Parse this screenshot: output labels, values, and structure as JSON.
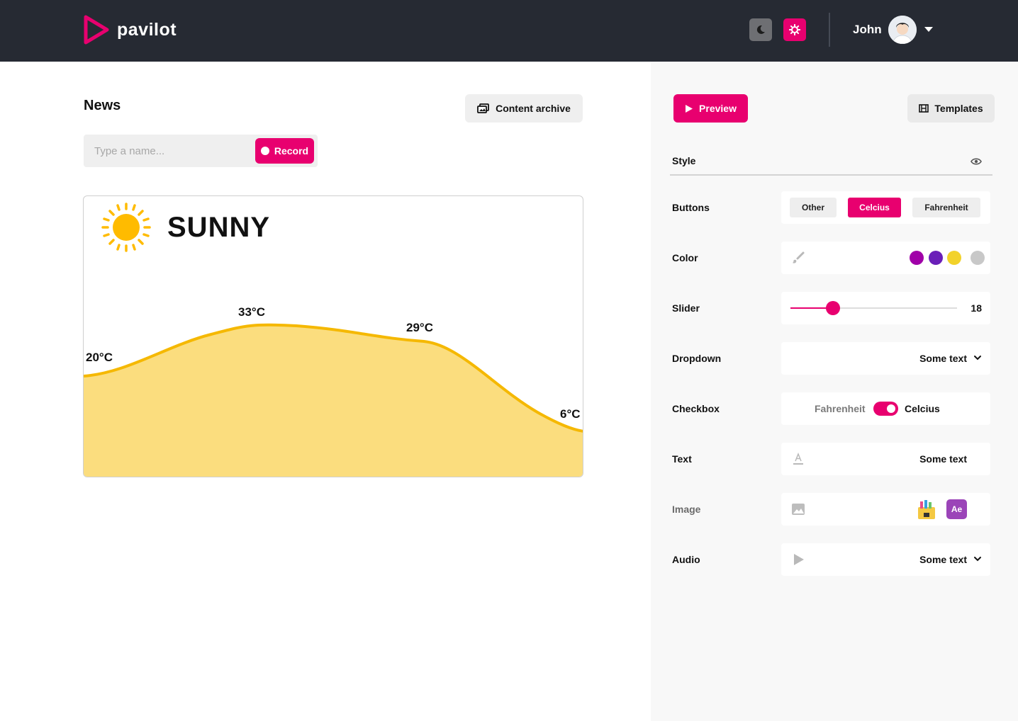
{
  "header": {
    "brand": "pavilot",
    "user_name": "John",
    "icons": {
      "theme_dark": "moon-icon",
      "theme_light": "sun-gear-icon",
      "user_menu": "caret-down-icon"
    },
    "colors": {
      "background": "#262a33",
      "accent": "#e8006f"
    }
  },
  "main": {
    "title": "News",
    "content_archive_label": "Content archive",
    "name_placeholder": "Type a name...",
    "record_label": "Record",
    "weather": {
      "condition": "SUNNY",
      "temps": [
        "20°C",
        "33°C",
        "29°C",
        "6°C"
      ]
    }
  },
  "panel": {
    "preview_label": "Preview",
    "templates_label": "Templates",
    "style_label": "Style",
    "rows": {
      "buttons": {
        "label": "Buttons",
        "options": [
          "Other",
          "Celcius",
          "Fahrenheit"
        ],
        "selected": "Celcius"
      },
      "color": {
        "label": "Color",
        "swatches": [
          "#a000a8",
          "#6a1fb8",
          "#f2d22a",
          "#c8c8c8"
        ]
      },
      "slider": {
        "label": "Slider",
        "value": "18",
        "fraction": 0.255
      },
      "dropdown": {
        "label": "Dropdown",
        "value": "Some text"
      },
      "checkbox": {
        "label": "Checkbox",
        "off_label": "Fahrenheit",
        "on_label": "Celcius",
        "checked": true
      },
      "text": {
        "label": "Text",
        "value": "Some text"
      },
      "image": {
        "label": "Image",
        "app_tile": "Ae"
      },
      "audio": {
        "label": "Audio",
        "value": "Some text"
      }
    }
  }
}
